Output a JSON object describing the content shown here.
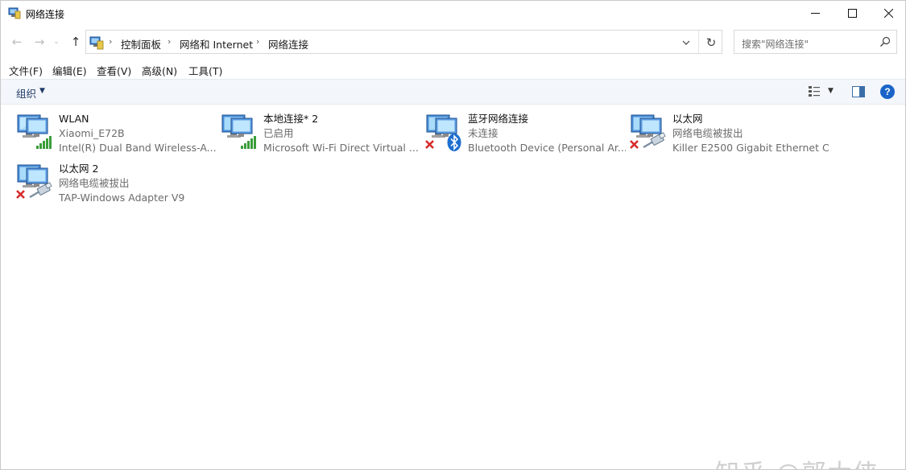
{
  "window": {
    "title": "网络连接"
  },
  "window_controls": {
    "minimize": "—",
    "maximize": "☐",
    "close": "✕"
  },
  "nav": {
    "back": "←",
    "forward": "→",
    "recent": "⌄",
    "up": "↑"
  },
  "breadcrumb": [
    {
      "label": "控制面板"
    },
    {
      "label": "网络和 Internet"
    },
    {
      "label": "网络连接"
    }
  ],
  "address": {
    "separator": "›",
    "dropdown": "⌄",
    "refresh": "↻"
  },
  "search": {
    "placeholder": "搜索\"网络连接\""
  },
  "menu": [
    {
      "label": "文件(F)"
    },
    {
      "label": "编辑(E)"
    },
    {
      "label": "查看(V)"
    },
    {
      "label": "高级(N)"
    },
    {
      "label": "工具(T)"
    }
  ],
  "toolbar": {
    "organize": "组织",
    "caret": "▼",
    "help": "?"
  },
  "connections": [
    {
      "name": "WLAN",
      "status": "Xiaomi_E72B",
      "device": "Intel(R) Dual Band Wireless-A...",
      "badge": "signal-bars-icon",
      "disconnected": false
    },
    {
      "name": "本地连接* 2",
      "status": "已启用",
      "device": "Microsoft Wi-Fi Direct Virtual ...",
      "badge": "signal-bars-icon",
      "disconnected": false
    },
    {
      "name": "蓝牙网络连接",
      "status": "未连接",
      "device": "Bluetooth Device (Personal Ar...",
      "badge": "bluetooth-icon",
      "disconnected": true
    },
    {
      "name": "以太网",
      "status": "网络电缆被拔出",
      "device": "Killer E2500 Gigabit Ethernet C...",
      "badge": "ethernet-cable-icon",
      "disconnected": true
    },
    {
      "name": "以太网 2",
      "status": "网络电缆被拔出",
      "device": "TAP-Windows Adapter V9",
      "badge": "ethernet-cable-icon",
      "disconnected": true
    }
  ],
  "watermark": "知乎 @郭大侠",
  "colors": {
    "accent": "#1a64c8",
    "toolbar_bg": "#f3f6fa",
    "signal_green": "#3a9d3a",
    "error_red": "#d62a2a"
  }
}
